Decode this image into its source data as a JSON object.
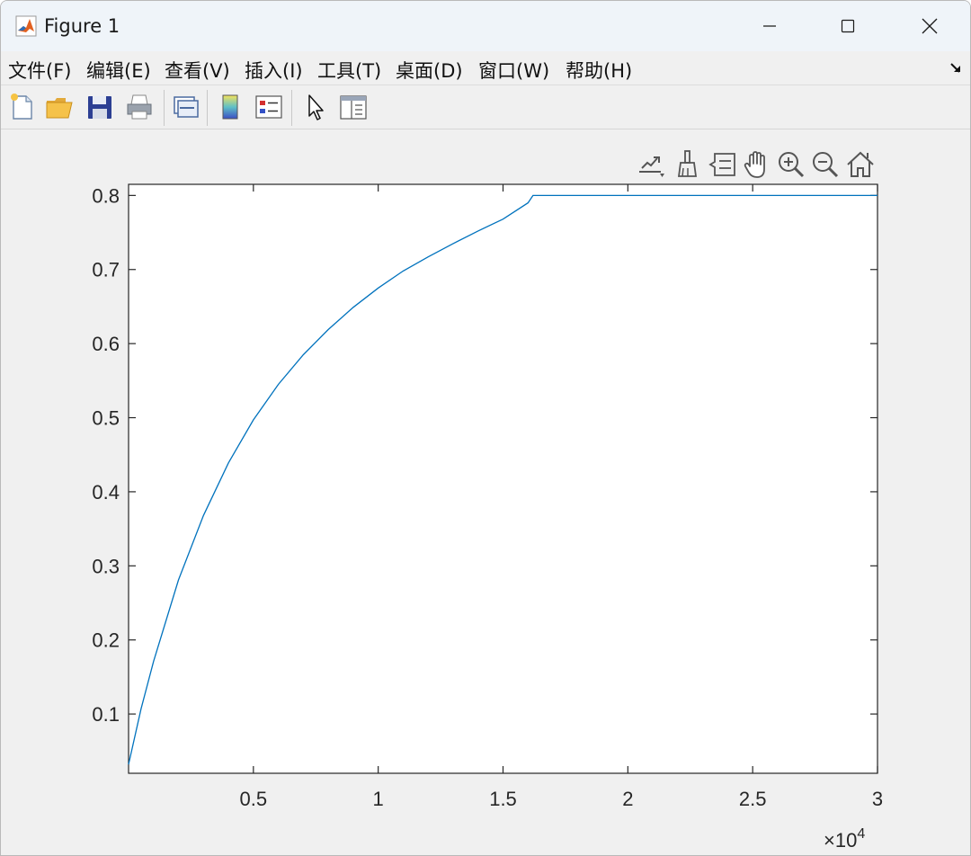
{
  "window": {
    "title": "Figure 1",
    "icon": "matlab-logo-icon",
    "controls": [
      "minimize-icon",
      "maximize-icon",
      "close-icon"
    ]
  },
  "menu": {
    "items": [
      {
        "label": "文件(F)"
      },
      {
        "label": "编辑(E)"
      },
      {
        "label": "查看(V)"
      },
      {
        "label": "插入(I)"
      },
      {
        "label": "工具(T)"
      },
      {
        "label": "桌面(D)"
      },
      {
        "label": "窗口(W)"
      },
      {
        "label": "帮助(H)"
      }
    ],
    "dock_icon": "undock-arrow-icon"
  },
  "toolbar": {
    "buttons": [
      "new-figure-icon",
      "open-file-icon",
      "save-icon",
      "print-icon",
      "link-plot-icon",
      "colorbar-icon",
      "legend-icon",
      "edit-plot-cursor-icon",
      "property-inspector-icon"
    ]
  },
  "axes_toolbar": {
    "buttons": [
      "export-icon",
      "brush-icon",
      "data-tips-icon",
      "pan-hand-icon",
      "zoom-in-icon",
      "zoom-out-icon",
      "home-restore-icon"
    ]
  },
  "chart_data": {
    "type": "line",
    "title": "",
    "xlabel": "",
    "ylabel": "",
    "x_exponent_label": "×10",
    "x_exponent_power": "4",
    "xlim": [
      0,
      30000
    ],
    "ylim": [
      0.02,
      0.815
    ],
    "xticks": [
      5000,
      10000,
      15000,
      20000,
      25000,
      30000
    ],
    "xtick_labels": [
      "0.5",
      "1",
      "1.5",
      "2",
      "2.5",
      "3"
    ],
    "yticks": [
      0.1,
      0.2,
      0.3,
      0.4,
      0.5,
      0.6,
      0.7,
      0.8
    ],
    "ytick_labels": [
      "0.1",
      "0.2",
      "0.3",
      "0.4",
      "0.5",
      "0.6",
      "0.7",
      "0.8"
    ],
    "grid": false,
    "series": [
      {
        "color": "#0072bd",
        "x": [
          0,
          500,
          1000,
          2000,
          3000,
          4000,
          5000,
          6000,
          7000,
          8000,
          9000,
          10000,
          11000,
          12000,
          13000,
          14000,
          15000,
          16000,
          16200,
          18000,
          20000,
          22000,
          24000,
          26000,
          28000,
          30000
        ],
        "y": [
          0.032,
          0.107,
          0.171,
          0.281,
          0.368,
          0.439,
          0.497,
          0.545,
          0.585,
          0.619,
          0.649,
          0.675,
          0.698,
          0.717,
          0.735,
          0.752,
          0.768,
          0.79,
          0.8,
          0.8,
          0.8,
          0.8,
          0.8,
          0.8,
          0.8,
          0.8
        ]
      }
    ]
  }
}
